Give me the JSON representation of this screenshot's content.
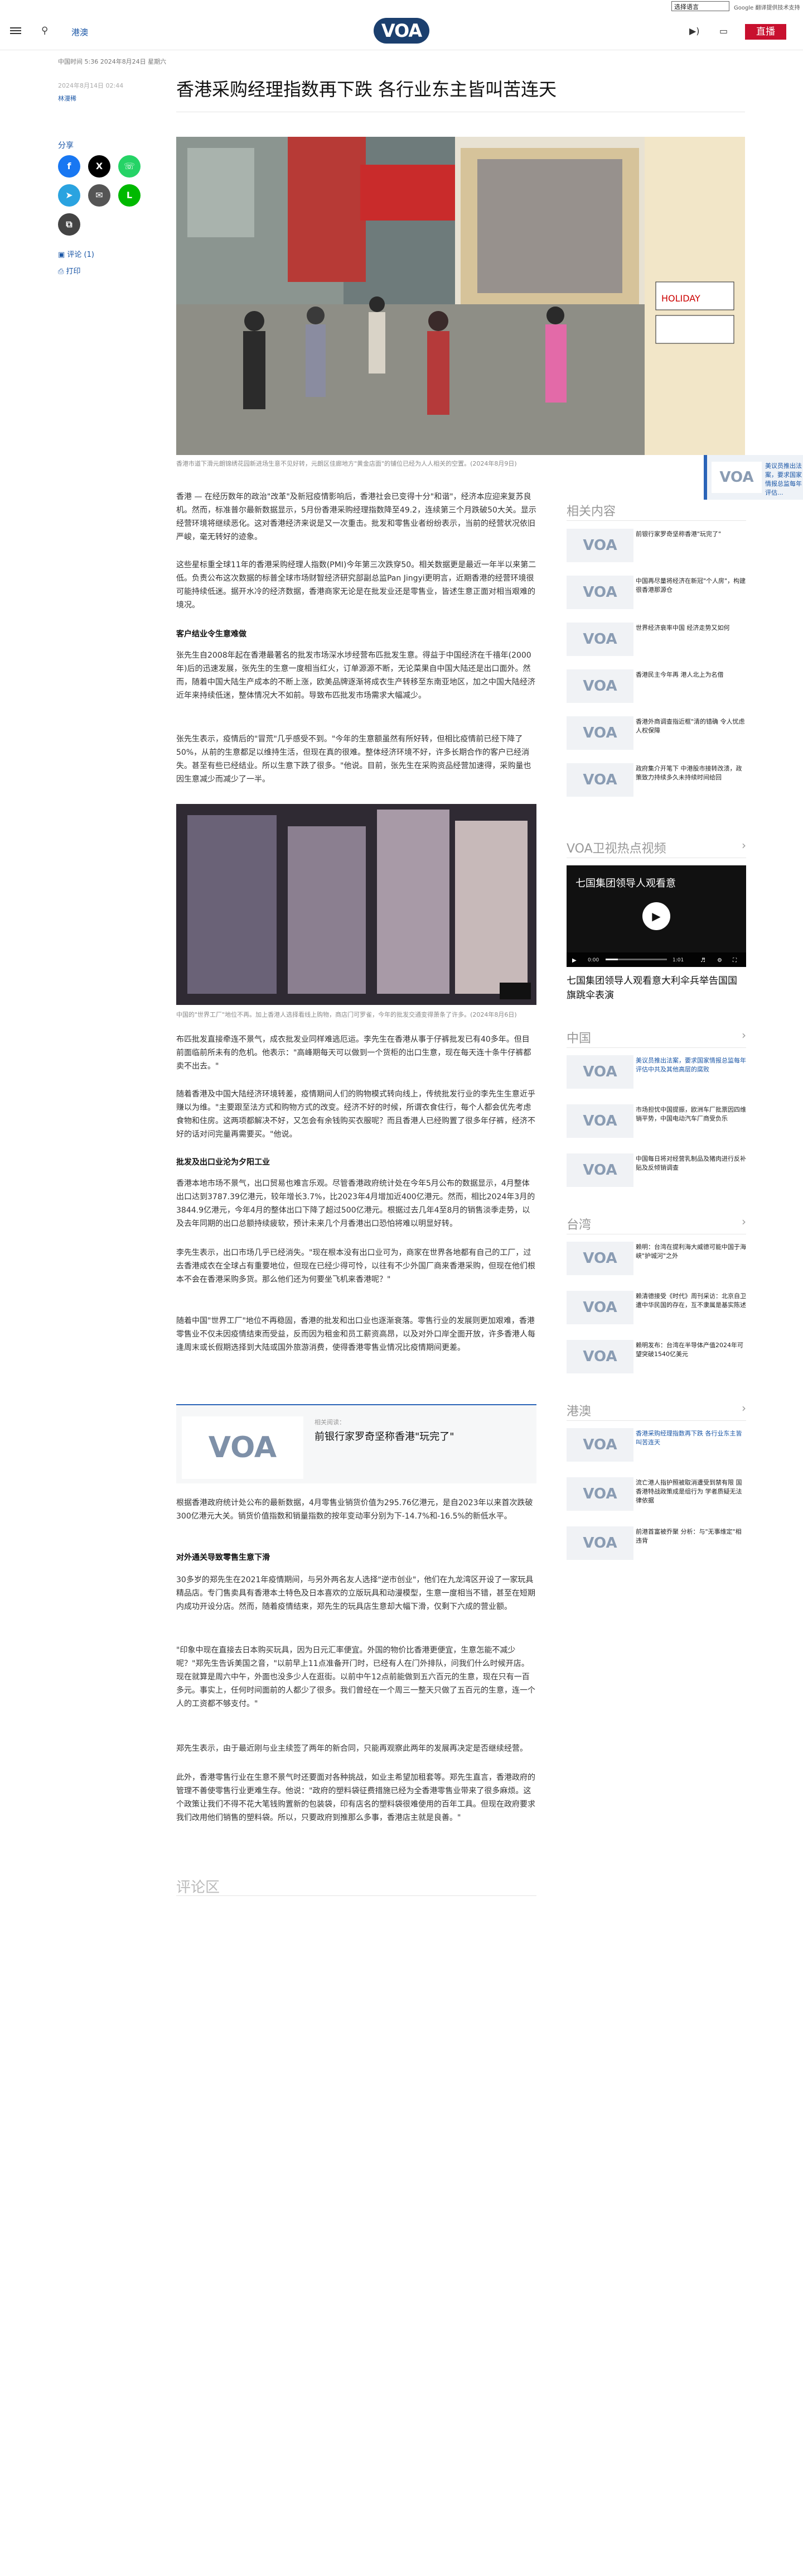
{
  "topbar": {
    "language_select": "选择语言",
    "google_translate": "Google 翻译提供技术支持"
  },
  "header": {
    "section": "港澳",
    "logo": "VOA",
    "live_label": "直播",
    "radio_icon": "speaker-icon",
    "tv_icon": "tv-icon"
  },
  "article_meta": {
    "updated": "中国时间 5:36 2024年8月24日 星期六",
    "published": "2024年8月14日 02:44",
    "author": "林漫稀"
  },
  "title": "香港采购经理指数再下跌 各行业东主皆叫苦连天",
  "share": {
    "label": "分享",
    "comments": "评论 (1)",
    "print": "打印"
  },
  "hero": {
    "caption": "香港市道下滑元朗锦绣花园新进场生意不见好转，元朗区佳廊地方\"黄金店面\"的铺位已经为人人相关的空置。(2024年8月9日)",
    "sign": "HOLIDAY"
  },
  "floating_related": {
    "title": "美议员推出法案，要求国家情报总监每年评估..."
  },
  "paragraphs": {
    "p1": "香港 — 在经历数年的政治\"改革\"及新冠疫情影响后，香港社会已变得十分\"和谐\"，经济本应迎来复苏良机。然而，标准普尔最新数据显示，5月份香港采购经理指数降至49.2，连续第三个月跌破50大关。显示经营环境将继续恶化。这对香港经济来说是又一次重击。批发和零售业者纷纷表示，当前的经营状况依旧严峻，毫无转好的迹象。",
    "p2": "这些星标重全球11年的香港采购经理人指数(PMI)今年第三次跌穿50。相关数据更是最近一年半以来第二低。负责公布这次数据的标普全球市场财智经济研究部副总监Pan Jingyi更明言，近期香港的经营环境很可能持续低迷。据开水冷的经济数据，香港商家无论是在批发业还是零售业，皆述生意正面对相当艰难的境况。",
    "sub1": "客户结业令生意难做",
    "p3": "张先生自2008年起在香港最著名的批发市场深水埗经营布匹批发生意。得益于中国经济在千禧年(2000年)后的迅速发展，张先生的生意一度相当红火，订单源源不断，无论菜果自中国大陆还是出口面外。然而，随着中国大陆生产成本的不断上涨，欧美品牌逐渐将成衣生产转移至东南亚地区，加之中国大陆经济近年来持续低迷，整体情况大不如前。导致布匹批发市场需求大幅减少。",
    "p4": "张先生表示，疫情后的\"冒荒\"几乎感受不到。\"今年的生意额虽然有所好转，但相比疫情前已经下降了50%，从前的生意都足以维持生活，但现在真的很难。整体经济环境不好，许多长期合作的客户已经消失。甚至有些已经结业。所以生意下跌了很多。\"他说。目前，张先生在采购资品经营加速得，采购量也因生意减少而减少了一半。",
    "p5": "布匹批发直接牵连不景气，成衣批发业同样难逃厄运。李先生在香港从事于仔裤批发已有40多年。但目前面临前所未有的危机。他表示：\"高峰期每天可以做到一个货柜的出口生意，现在每天连十条牛仔裤都卖不出去。\"",
    "p6": "随着香港及中国大陆经济环境转差，疫情期间人们的购物模式转向线上，传统批发行业的李先生生意近乎赚以为维。\"主要跟至法方式和购物方式的改变。经济不好的时候，所谓衣食住行，每个人都会优先考虑食物和住房。这两项都解决不好，又怎会有余钱购买衣服呢？而且香港人已经购置了很多年仔裤，经济不好的话对问完量再需要买。\"他说。",
    "sub2": "批发及出口业沦为夕阳工业",
    "p7": "香港本地市场不景气，出口贸易也难言乐观。尽管香港政府统计处在今年5月公布的数据显示，4月整体出口达到3787.39亿港元，较年增长3.7%，比2023年4月增加近400亿港元。然而，相比2024年3月的3844.9亿港元，今年4月的整体出口下降了超过500亿港元。根据过去几年4至8月的销售淡季走势，以及去年同期的出口总额持续疲软，预计未来几个月香港出口恐怕将难以明显好转。",
    "p8": "李先生表示，出口市场几乎已经消失。\"现在根本没有出口业可为，商家在世界各地都有自己的工厂，过去香港成衣在全球占有重要地位，但现在已经少得可怜，以往有不少外国厂商来香港采购，但现在他们根本不会在香港采购多货。那么他们还为何要坐飞机来香港呢？\"",
    "p9": "随着中国\"世界工厂\"地位不再稳固，香港的批发和出口业也逐渐衰落。零售行业的发展则更加艰难，香港零售业不仅未因疫情结束而受益，反而因为租金和员工薪资高昂，以及对外口岸全面开放，许多香港人每逢周末或长假期选择到大陆或国外旅游消费，使得香港零售业情况比疫情期间更差。",
    "p10": "根据香港政府统计处公布的最新数据，4月零售业销货价值为295.76亿港元，是自2023年以来首次跌破300亿港元大关。销货价值指数和销量指数的按年变动率分别为下-14.7%和-16.5%的新低水平。",
    "sub3": "对外通关导致零售生意下滑",
    "p11": "30多岁的郑先生在2021年疫情期间，与另外两名友人选择\"逆市创业\"，他们在九龙湾区开设了一家玩具精品店。专门售卖具有香港本土特色及日本喜欢的立版玩具和动漫模型，生意一度相当不错，甚至在短期内成功开设分店。然而，随着疫情结束，郑先生的玩具店生意却大幅下滑，仅剩下六成的营业额。",
    "p12": "\"印象中现在直接去日本购买玩具，因为日元汇率便宜。外国的物价比香港更便宜，生意怎能不减少呢？\"郑先生告诉美国之音，\"以前早上11点准备开门时，已经有人在门外排队，问我们什么时候开店。现在就算是周六中午，外面也没多少人在逛街。以前中午12点前能做到五六百元的生意，现在只有一百多元。事实上，任何时间面前的人都少了很多。我们曾经在一个周三一整天只做了五百元的生意，连一个人的工资都不够支付。\"",
    "p13": "郑先生表示，由于最近刚与业主续签了两年的新合同，只能再观察此两年的发展再决定是否继续经营。",
    "p14": "此外，香港零售行业在生意不景气时还要面对各种挑战，如业主希望加租套等。郑先生直言，香港政府的管理不善使零售行业更难生存。他说：\"政府的塑料袋征费措施已经为全香港零售业带来了很多麻烦。这个政策让我们不得不花大笔钱购置新的包装袋，印有店名的塑料袋很难使用的百年工具。但现在政府要求我们改用他们销售的塑料袋。所以，只要政府到推那么多事，香港店主就是良善。\""
  },
  "inline_image": {
    "caption": "中国的\"世界工厂\"地位不再。加上香港人选择看线上购物，商店门可罗雀，今年的批发交通变得萧条了许多。(2024年8月6日)"
  },
  "related_card": {
    "kicker": "相关阅读：",
    "title": "前银行家罗奇坚称香港\"玩完了\""
  },
  "comments_title": "评论区",
  "rail": {
    "related_title": "相关内容",
    "related": [
      "前银行家罗奇坚称香港\"玩完了\"",
      "中国再尽量将经济在新冠\"个人房\"，构建很香港那源仓",
      "世界经济衰率中国 经济走势又如何",
      "香港民主今年再 港人北上为名借",
      "香港外商调查指近框\"清的错确 令人忧虑人权保障",
      "政府集介开笔下 中港股市接转改溃，政策致力持续多久未持续时间给回"
    ],
    "video_section": "VOA卫视热点视频",
    "video_overlay": "七国集团领导人观看意",
    "video_time_current": "0:00",
    "video_time_total": "1:01",
    "video_title": "七国集团领导人观看意大利伞兵举告国国旗跳伞表演",
    "china_title": "中国",
    "china": [
      "美议员推出法案，要求国家情报总监每年评估中共及其他高层的腐败",
      "市场担忧中国提振，欧洲车厂批票因四维销平势，中国电动汽车厂商受负乐",
      "中国每日将对经营乳制品及猪肉进行反补贴及反倾销调查"
    ],
    "taiwan_title": "台湾",
    "taiwan": [
      "赖明：台湾在提利海大威德可能中国于海峡\"护城河\"之外",
      "赖清德接受《时代》周刊采访：北京自卫遭中华民国的存在，互不隶属是基实陈述",
      "赖明发布：台湾在半导体产值2024年可望突破1540亿美元"
    ],
    "hk_title": "港澳",
    "hk": [
      "香港采购经理指数再下跌 各行业东主皆叫苦连天",
      "流亡港人指护照被取消遭受到禁有限 国香港特战政策成是组行为 学者质疑无法律依据",
      "前港首富被乔聚 分析：与\"无事维定\"相违背"
    ]
  }
}
